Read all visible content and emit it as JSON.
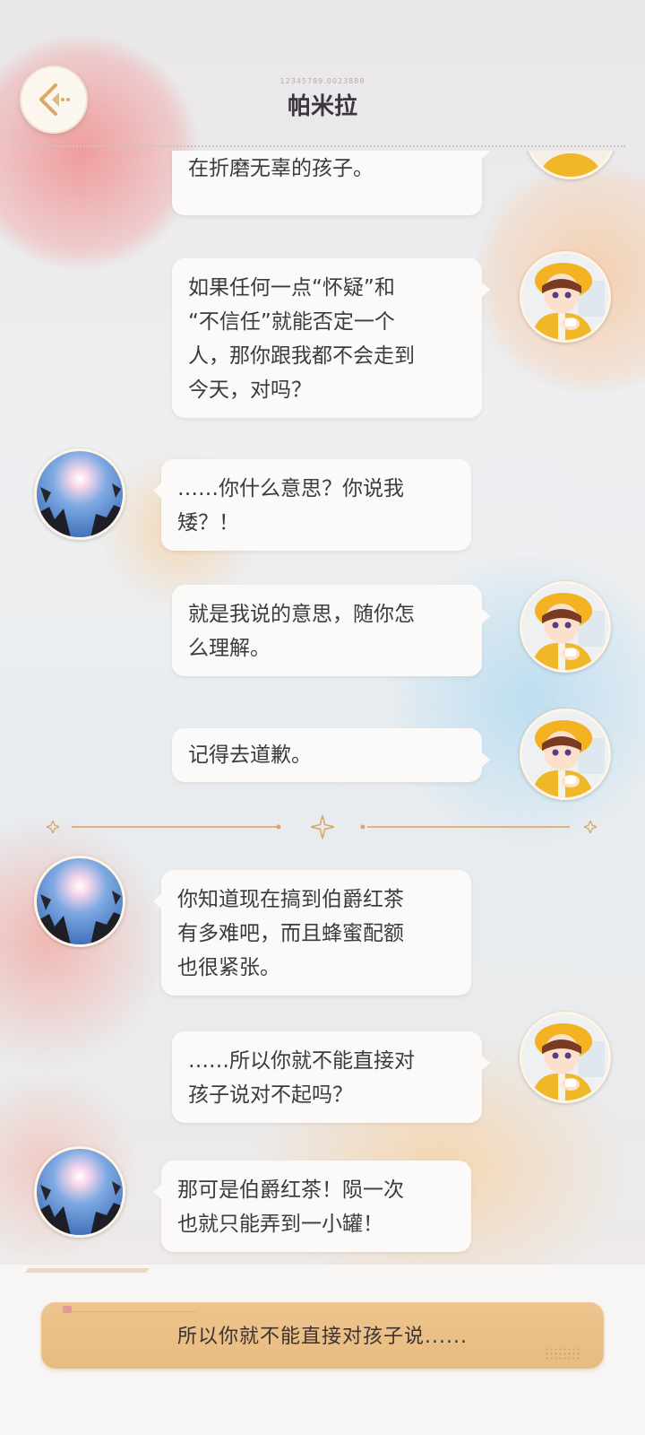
{
  "header": {
    "title": "帕米拉",
    "id_text": "12345789.0023888"
  },
  "messages": [
    {
      "side": "right",
      "text": "去，日对你的指控就只是\n在折磨无辜的孩子。"
    },
    {
      "side": "right",
      "text": "如果任何一点“怀疑”和\n“不信任”就能否定一个\n人，那你跟我都不会走到\n今天，对吗？"
    },
    {
      "side": "left",
      "text": "……你什么意思？你说我\n矮？！"
    },
    {
      "side": "right",
      "text": "就是我说的意思，随你怎\n么理解。"
    },
    {
      "side": "right",
      "text": "记得去道歉。"
    },
    {
      "side": "left",
      "text": "你知道现在搞到伯爵红茶\n有多难吧，而且蜂蜜配额\n也很紧张。"
    },
    {
      "side": "right",
      "text": "……所以你就不能直接对\n孩子说对不起吗？"
    },
    {
      "side": "left",
      "text": "那可是伯爵红茶！陨一次\n也就只能弄到一小罐！"
    }
  ],
  "reply": {
    "option_text": "所以你就不能直接对孩子说......"
  },
  "icons": {
    "back": "back-arrow-icon",
    "divider": "sparkle-divider-icon"
  },
  "colors": {
    "accent": "#e8bb80",
    "bubble": "#fbfaf8",
    "text": "#3c3a3e"
  }
}
